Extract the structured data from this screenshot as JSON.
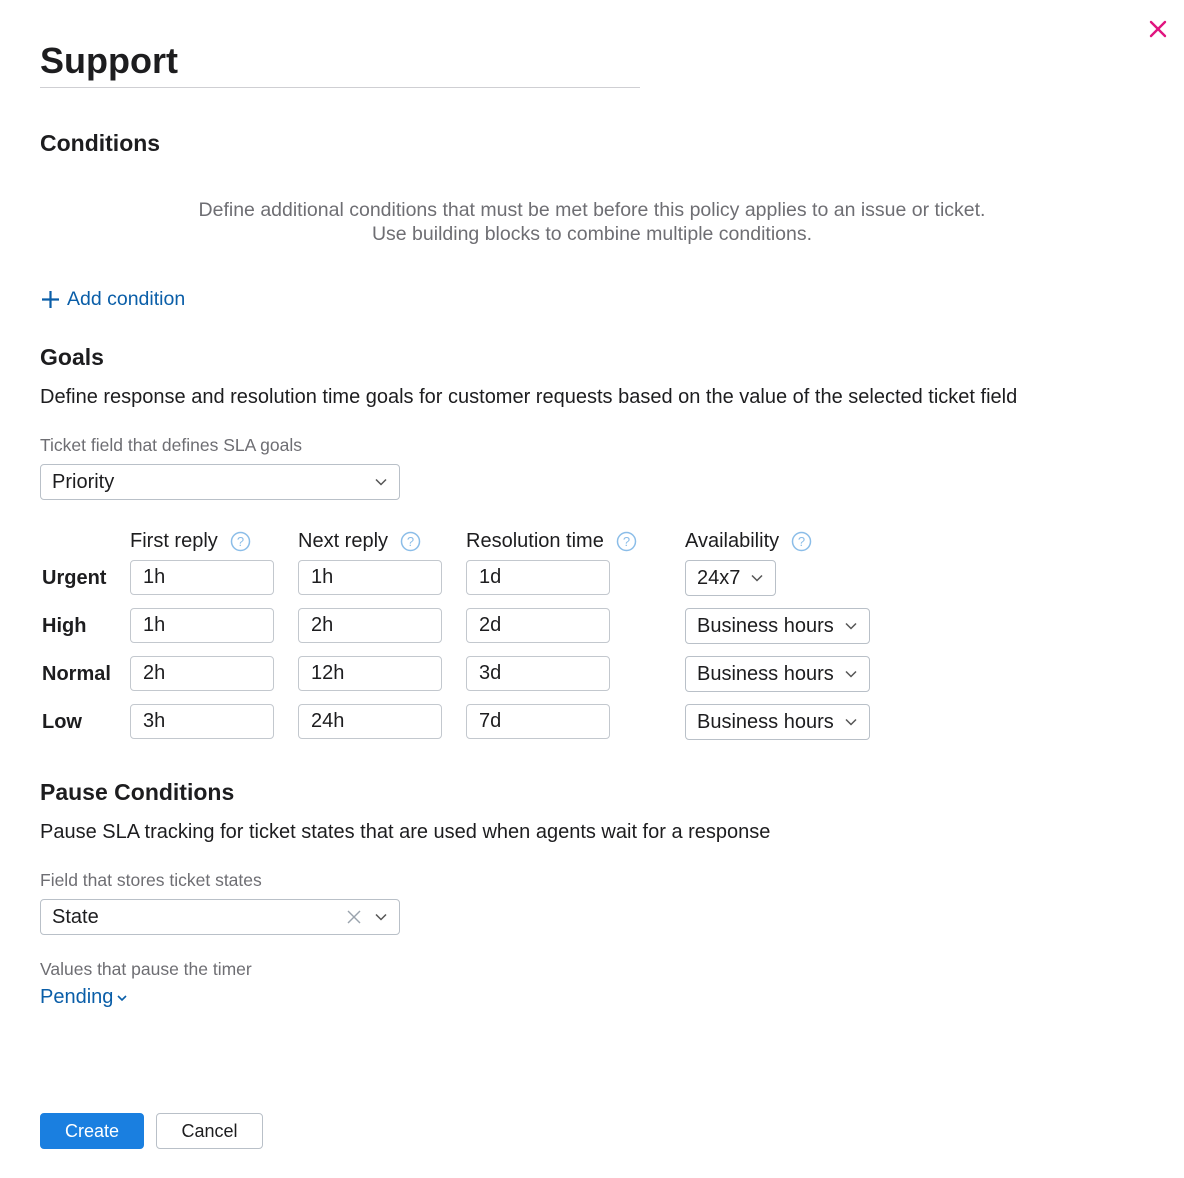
{
  "title": "Support",
  "close_icon": "close-icon",
  "conditions": {
    "heading": "Conditions",
    "line1": "Define additional conditions that must be met before this policy applies to an issue or ticket.",
    "line2": "Use building blocks to combine multiple conditions.",
    "add_label": "Add condition",
    "add_icon": "plus-icon"
  },
  "goals": {
    "heading": "Goals",
    "description": "Define response and resolution time goals for customer requests based on the value of the selected ticket field",
    "field_label": "Ticket field that defines SLA goals",
    "field_value": "Priority",
    "columns": [
      "First reply",
      "Next reply",
      "Resolution time",
      "Availability"
    ],
    "rows": [
      {
        "label": "Urgent",
        "first_reply": "1h",
        "next_reply": "1h",
        "resolution": "1d",
        "availability": "24x7"
      },
      {
        "label": "High",
        "first_reply": "1h",
        "next_reply": "2h",
        "resolution": "2d",
        "availability": "Business hours"
      },
      {
        "label": "Normal",
        "first_reply": "2h",
        "next_reply": "12h",
        "resolution": "3d",
        "availability": "Business hours"
      },
      {
        "label": "Low",
        "first_reply": "3h",
        "next_reply": "24h",
        "resolution": "7d",
        "availability": "Business hours"
      }
    ]
  },
  "pause": {
    "heading": "Pause Conditions",
    "description": "Pause SLA tracking for ticket states that are used when agents wait for a response",
    "field_label": "Field that stores ticket states",
    "field_value": "State",
    "values_label": "Values that pause the timer",
    "values_value": "Pending"
  },
  "buttons": {
    "create": "Create",
    "cancel": "Cancel"
  },
  "colors": {
    "accent": "#1a7fe0",
    "link": "#0a5ea8",
    "close": "#e0157f"
  }
}
